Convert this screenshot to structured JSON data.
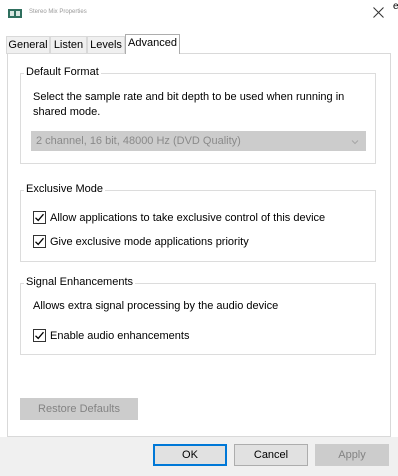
{
  "window": {
    "title": "Stereo Mix Properties",
    "app_icon": "speaker-properties-icon",
    "close_icon": "close-icon",
    "edge_glyph": "e"
  },
  "tabs": [
    {
      "label": "General",
      "active": false
    },
    {
      "label": "Listen",
      "active": false
    },
    {
      "label": "Levels",
      "active": false
    },
    {
      "label": "Advanced",
      "active": true
    }
  ],
  "default_format": {
    "title": "Default Format",
    "description": "Select the sample rate and bit depth to be used when running in shared mode.",
    "selected": "2 channel, 16 bit, 48000 Hz (DVD Quality)",
    "enabled": false
  },
  "exclusive_mode": {
    "title": "Exclusive Mode",
    "options": [
      {
        "label": "Allow applications to take exclusive control of this device",
        "checked": true
      },
      {
        "label": "Give exclusive mode applications priority",
        "checked": true
      }
    ]
  },
  "signal_enhancements": {
    "title": "Signal Enhancements",
    "description": "Allows extra signal processing by the audio device",
    "options": [
      {
        "label": "Enable audio enhancements",
        "checked": true
      }
    ]
  },
  "restore_button": {
    "label": "Restore Defaults",
    "enabled": false
  },
  "footer": {
    "ok": "OK",
    "cancel": "Cancel",
    "apply": "Apply",
    "apply_enabled": false
  },
  "colors": {
    "accent": "#0078d7",
    "disabled_bg": "#cccccc",
    "disabled_text": "#838383",
    "footer_bg": "#f0f0f0"
  }
}
